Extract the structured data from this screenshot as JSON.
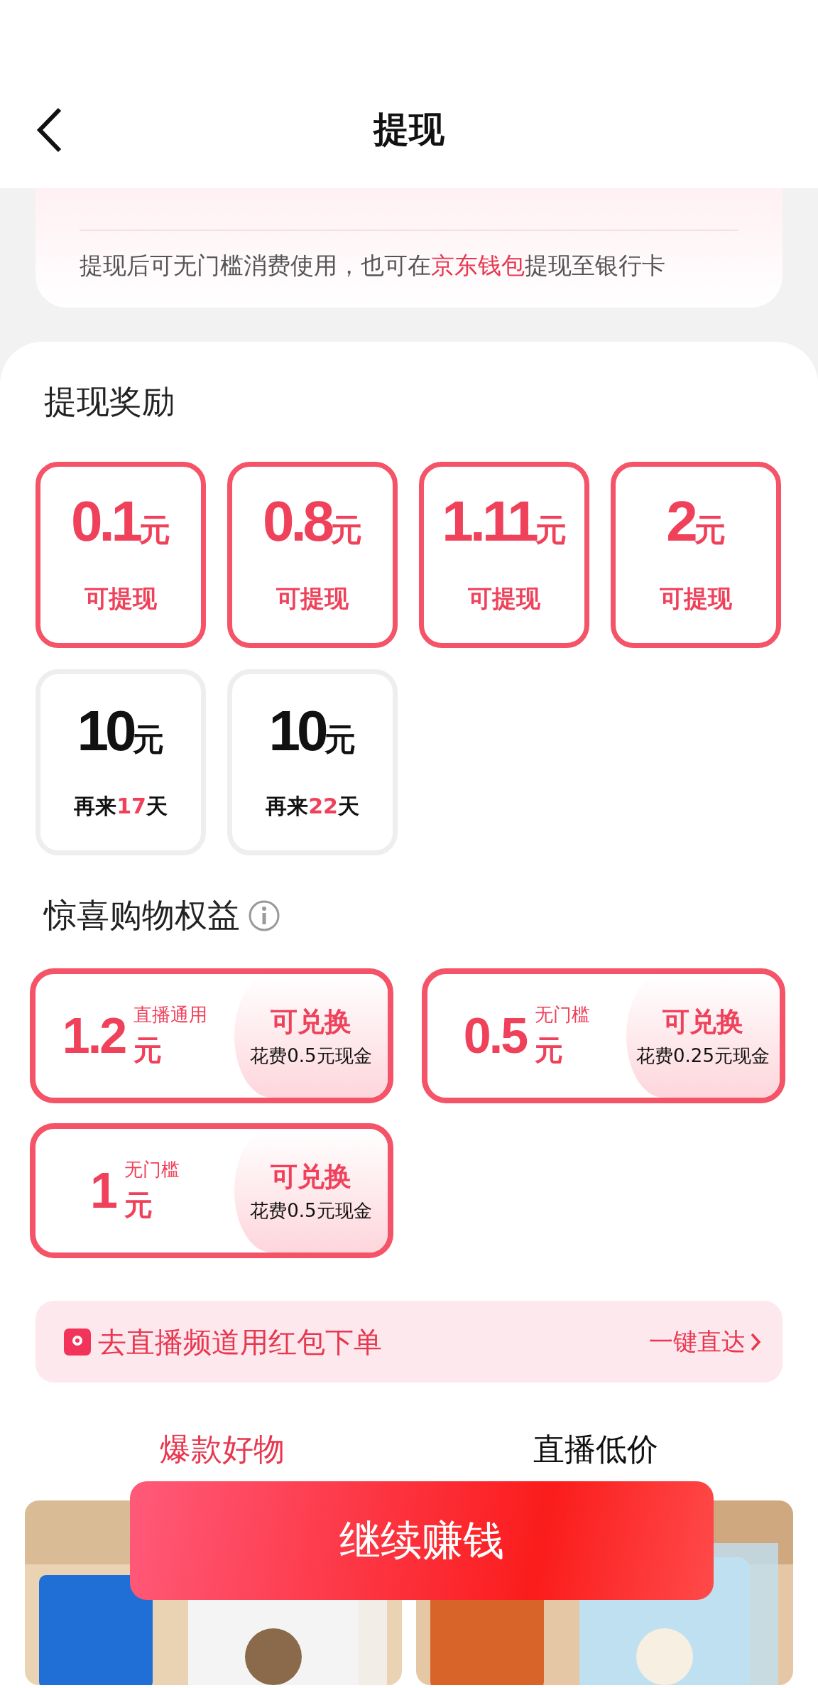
{
  "header": {
    "title": "提现"
  },
  "notice": {
    "text_before": "提现后可无门槛消费使用，也可在",
    "link": "京东钱包",
    "text_after": "提现至银行卡"
  },
  "rewards": {
    "title": "提现奖励",
    "items": [
      {
        "kind": "available",
        "amount": "0.1",
        "unit": "元",
        "label": "可提现"
      },
      {
        "kind": "available",
        "amount": "0.8",
        "unit": "元",
        "label": "可提现"
      },
      {
        "kind": "available",
        "amount": "1.11",
        "unit": "元",
        "label": "可提现"
      },
      {
        "kind": "available",
        "amount": "2",
        "unit": "元",
        "label": "可提现"
      },
      {
        "kind": "locked",
        "amount": "10",
        "unit": "元",
        "label_before": "再来",
        "days": "17",
        "label_after": "天"
      },
      {
        "kind": "locked",
        "amount": "10",
        "unit": "元",
        "label_before": "再来",
        "days": "22",
        "label_after": "天"
      }
    ]
  },
  "benefits": {
    "title": "惊喜购物权益",
    "items": [
      {
        "amount": "1.2",
        "tag": "直播通用",
        "unit": "元",
        "action": "可兑换",
        "cost": "花费0.5元现金"
      },
      {
        "amount": "0.5",
        "tag": "无门槛",
        "unit": "元",
        "action": "可兑换",
        "cost": "花费0.25元现金"
      },
      {
        "amount": "1",
        "tag": "无门槛",
        "unit": "元",
        "action": "可兑换",
        "cost": "花费0.5元现金"
      }
    ]
  },
  "banner": {
    "text": "去直播频道用红包下单",
    "link": "一键直达"
  },
  "tabs": [
    {
      "label": "爆款好物",
      "selected": true
    },
    {
      "label": "直播低价",
      "selected": false
    }
  ],
  "float_button": {
    "label": "继续赚钱"
  }
}
